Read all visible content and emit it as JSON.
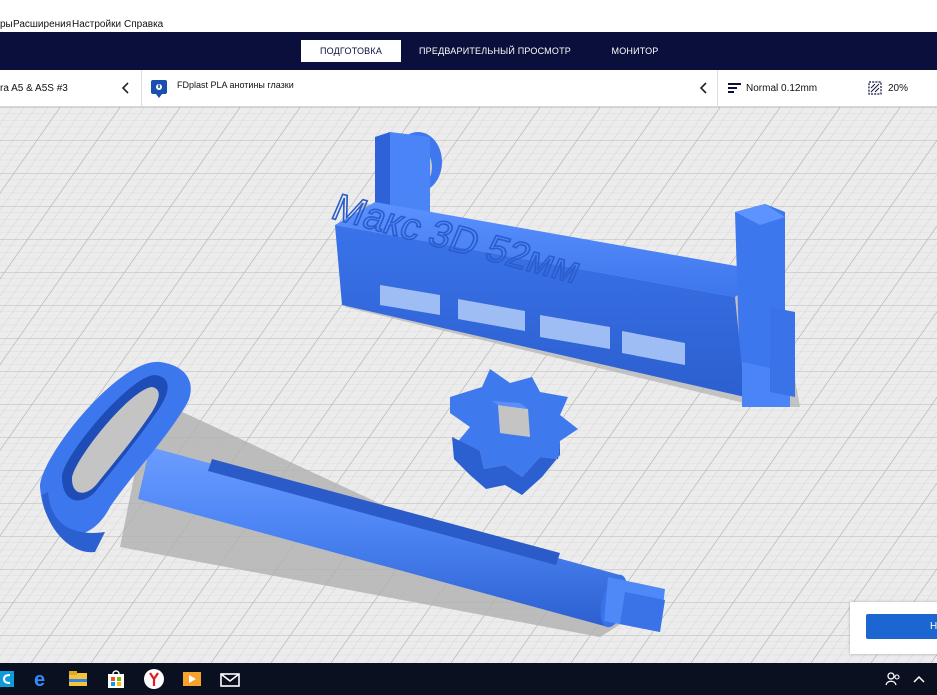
{
  "menu": {
    "items": [
      "ры",
      "Расширения",
      "Настройки",
      "Справка"
    ]
  },
  "stages": {
    "tabs": [
      "ПОДГОТОВКА",
      "ПРЕДВАРИТЕЛЬНЫЙ ПРОСМОТР",
      "МОНИТОР"
    ],
    "active": "ПОДГОТОВКА"
  },
  "toolbar": {
    "printer": "ra A5 & A5S #3",
    "material": "FDplast PLA анотины глазки",
    "profile": "Normal 0.12mm",
    "infill": "20%"
  },
  "model": {
    "text": "Макс 3D 52мм"
  },
  "slice_button": {
    "label": "Н"
  },
  "colors": {
    "stage_bar": "#0a0f3b",
    "model_blue": "#3b78ee",
    "accent": "#1b66d1",
    "taskbar": "#0b1020"
  },
  "taskbar": {
    "icons": [
      "cortana-icon",
      "edge-icon",
      "file-explorer-icon",
      "store-icon",
      "yandex-browser-icon",
      "media-player-icon",
      "mail-icon"
    ]
  }
}
